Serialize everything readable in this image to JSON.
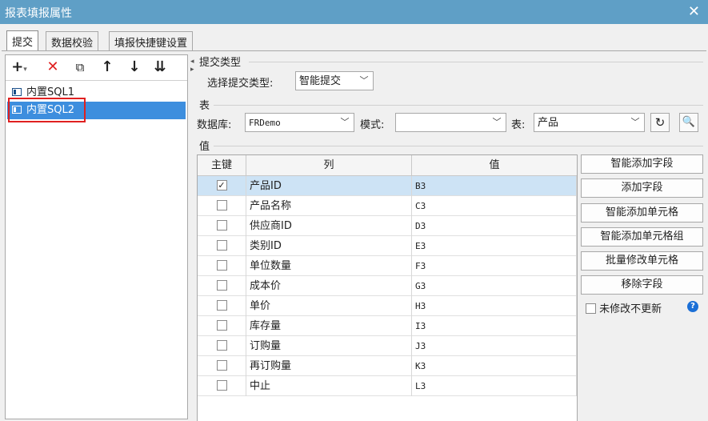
{
  "window": {
    "title": "报表填报属性",
    "close_glyph": "✕"
  },
  "tabs": [
    {
      "label": "提交"
    },
    {
      "label": "数据校验"
    },
    {
      "label": "填报快捷键设置"
    }
  ],
  "toolbar": {
    "icons": [
      "add-icon",
      "delete-icon",
      "copy-icon",
      "up-arrow-icon",
      "down-arrow-icon",
      "move-bottom-icon"
    ],
    "glyphs": {
      "add": "+",
      "add_drop": "▾",
      "delete": "✕",
      "copy": "⧉",
      "up": "↑",
      "down": "↓",
      "bottom": "⇊"
    }
  },
  "tree": [
    {
      "label": "内置SQL1",
      "selected": false
    },
    {
      "label": "内置SQL2",
      "selected": true
    }
  ],
  "submit_type": {
    "group_label": "提交类型",
    "select_label": "选择提交类型:",
    "value": "智能提交"
  },
  "table_section": {
    "group_label": "表",
    "db_label": "数据库:",
    "db_value": "FRDemo",
    "schema_label": "模式:",
    "schema_value": "",
    "table_label": "表:",
    "table_value": "产品"
  },
  "value_section": {
    "group_label": "值",
    "headers": {
      "key": "主键",
      "column": "列",
      "value": "值"
    },
    "rows": [
      {
        "key": true,
        "column": "产品ID",
        "value": "B3"
      },
      {
        "key": false,
        "column": "产品名称",
        "value": "C3"
      },
      {
        "key": false,
        "column": "供应商ID",
        "value": "D3"
      },
      {
        "key": false,
        "column": "类别ID",
        "value": "E3"
      },
      {
        "key": false,
        "column": "单位数量",
        "value": "F3"
      },
      {
        "key": false,
        "column": "成本价",
        "value": "G3"
      },
      {
        "key": false,
        "column": "单价",
        "value": "H3"
      },
      {
        "key": false,
        "column": "库存量",
        "value": "I3"
      },
      {
        "key": false,
        "column": "订购量",
        "value": "J3"
      },
      {
        "key": false,
        "column": "再订购量",
        "value": "K3"
      },
      {
        "key": false,
        "column": "中止",
        "value": "L3"
      }
    ]
  },
  "side_buttons": [
    {
      "label": "智能添加字段"
    },
    {
      "label": "添加字段"
    },
    {
      "label": "智能添加单元格"
    },
    {
      "label": "智能添加单元格组"
    },
    {
      "label": "批量修改单元格"
    },
    {
      "label": "移除字段"
    }
  ],
  "no_update_option": {
    "label": "未修改不更新",
    "checked": false,
    "help_glyph": "?"
  },
  "colors": {
    "titlebar": "#5f9fc6",
    "selection": "#3d8ede",
    "row_selection": "#cde3f5",
    "highlight_box": "#e02020",
    "delete_icon": "#e02020",
    "help_icon": "#1b6fd6"
  }
}
